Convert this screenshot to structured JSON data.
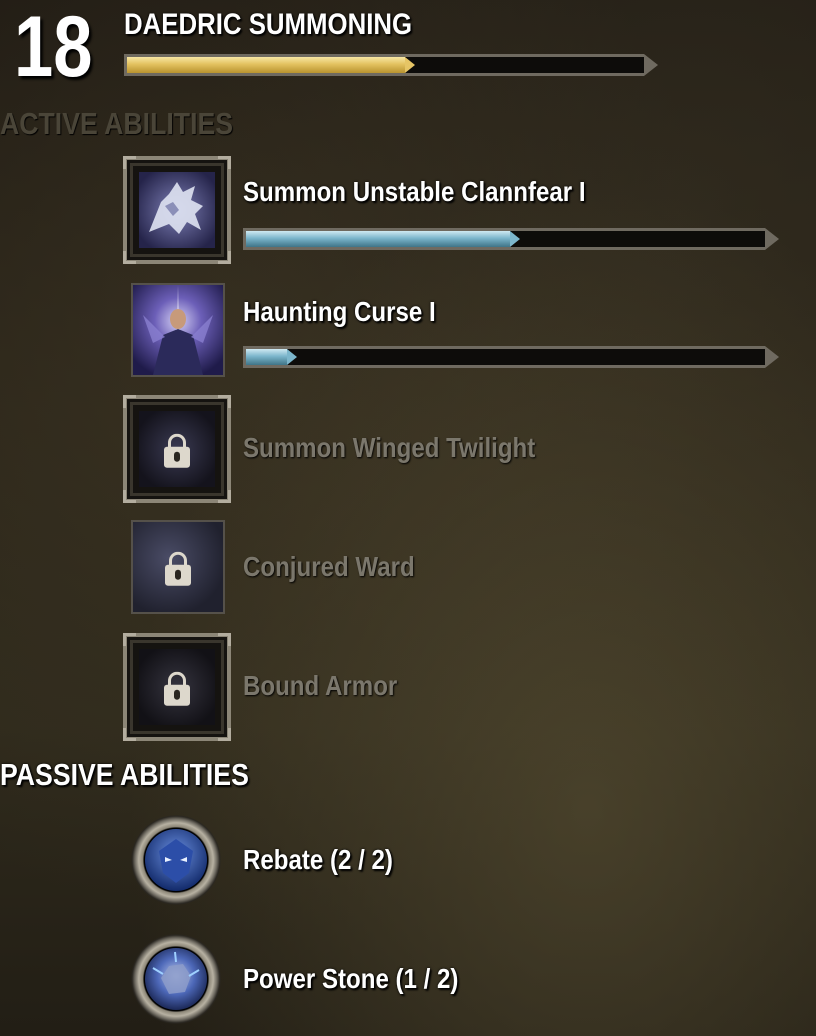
{
  "skill_line": {
    "rank": "18",
    "name": "DAEDRIC SUMMONING",
    "xp_progress": 0.55,
    "xp_bar_color": "#e6c565"
  },
  "sections": {
    "active_title": "ACTIVE ABILITIES",
    "passive_title": "PASSIVE ABILITIES"
  },
  "active_abilities": [
    {
      "name": "Summon Unstable Clannfear I",
      "icon": "clannfear-icon",
      "unlocked": true,
      "progress": 0.52
    },
    {
      "name": "Haunting Curse I",
      "icon": "haunting-curse-icon",
      "unlocked": true,
      "progress": 0.08
    },
    {
      "name": "Summon Winged Twilight",
      "icon": "lock-icon",
      "unlocked": false
    },
    {
      "name": "Conjured Ward",
      "icon": "lock-icon",
      "unlocked": false
    },
    {
      "name": "Bound Armor",
      "icon": "lock-icon",
      "unlocked": false
    }
  ],
  "passive_abilities": [
    {
      "name": "Rebate (2 / 2)",
      "icon": "rebate-icon"
    },
    {
      "name": "Power Stone (1 / 2)",
      "icon": "power-stone-icon"
    }
  ],
  "colors": {
    "ability_bar": "#7cb6cc",
    "locked_text": "#7b776c"
  }
}
